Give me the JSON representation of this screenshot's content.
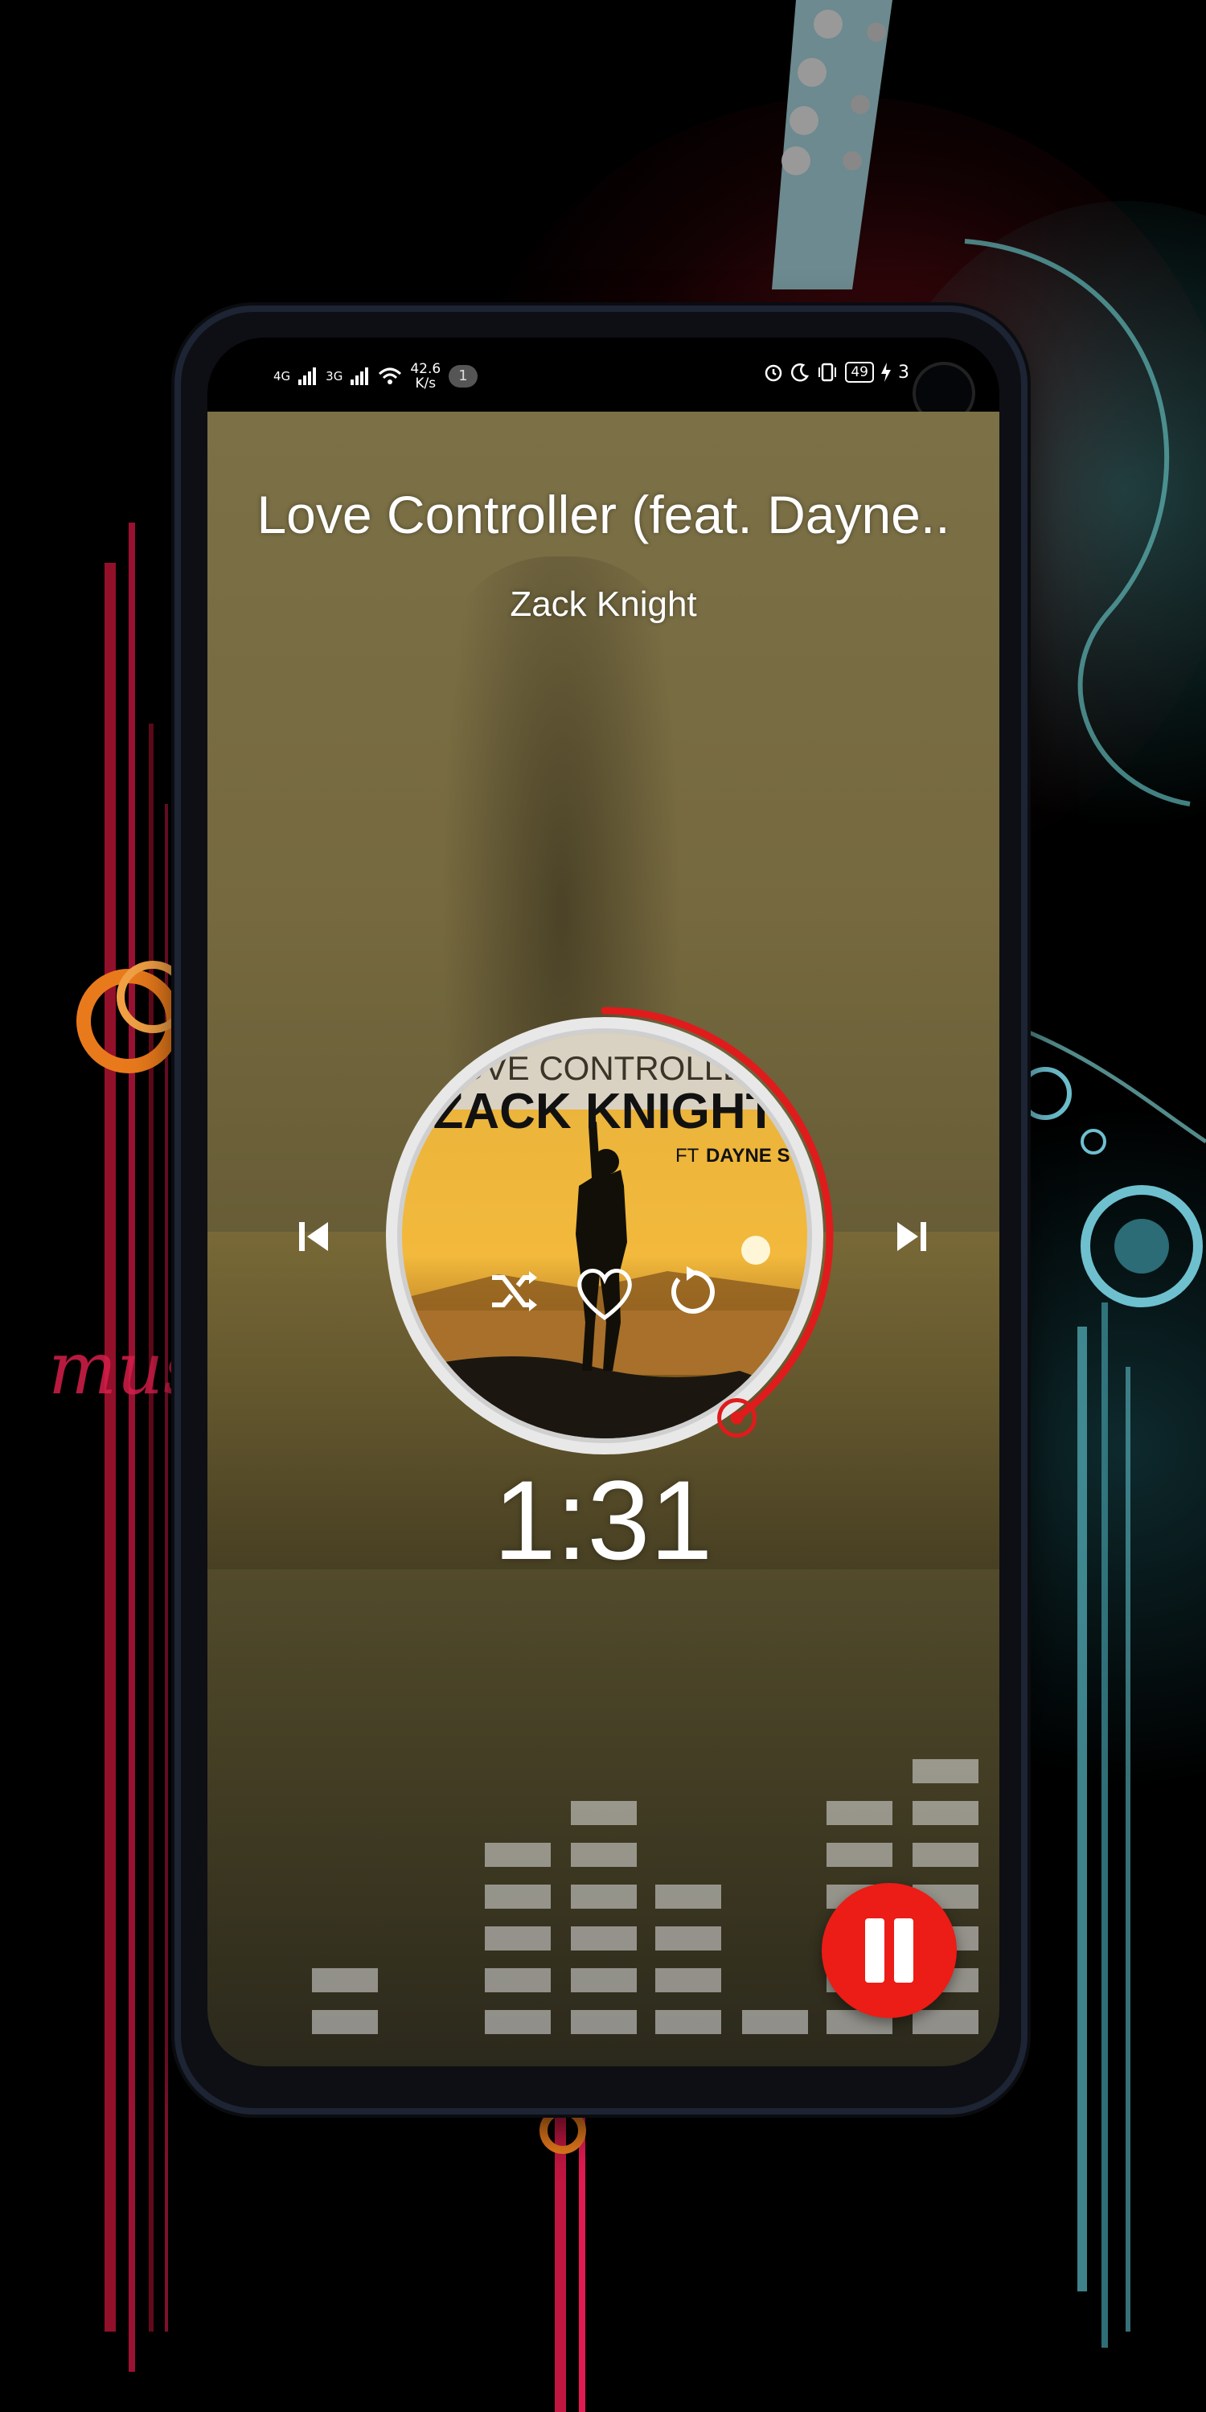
{
  "status_bar": {
    "network_1": "4G",
    "network_2": "3G",
    "speed_value": "42.6",
    "speed_unit": "K/s",
    "notification_count": "1",
    "battery": "49",
    "clock_fragment": "3"
  },
  "player": {
    "song_title": "Love Controller (feat. Dayne..",
    "artist": "Zack Knight",
    "elapsed_time": "1:31",
    "progress_fraction": 0.4
  },
  "album_art": {
    "line1": "LOVE CONTROLLER",
    "line2": "ZACK KNIGHT",
    "line3_prefix": "FT",
    "line3_name": "DAYNE S"
  },
  "background_text": {
    "script_word": "mus"
  },
  "colors": {
    "accent_red": "#ec1c16",
    "panel_tint": "#76693f"
  },
  "icons": {
    "previous": "skip-previous-icon",
    "next": "skip-next-icon",
    "shuffle": "shuffle-icon",
    "favorite": "heart-icon",
    "repeat": "repeat-icon",
    "play_pause": "pause-icon"
  }
}
